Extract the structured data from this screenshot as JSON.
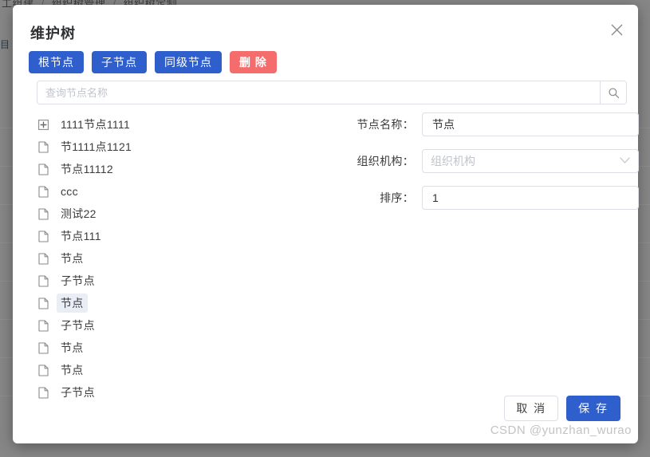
{
  "background": {
    "breadcrumb": [
      "工组建",
      "组织树管理",
      "组织树定制"
    ],
    "separator": "/",
    "sidebar_fragment": "目"
  },
  "dialog": {
    "title": "维护树",
    "close_icon": "close-icon",
    "actions": [
      {
        "label": "根节点",
        "style": "blue"
      },
      {
        "label": "子节点",
        "style": "blue"
      },
      {
        "label": "同级节点",
        "style": "blue"
      },
      {
        "label": "删 除",
        "style": "red"
      }
    ],
    "search": {
      "placeholder": "查询节点名称",
      "value": "",
      "button_icon": "search-icon"
    },
    "tree": [
      {
        "label": "1111节点1111",
        "icon": "expand-plus-icon",
        "selected": false
      },
      {
        "label": "节1111点1121",
        "icon": "file-icon",
        "selected": false
      },
      {
        "label": "节点11112",
        "icon": "file-icon",
        "selected": false
      },
      {
        "label": "ccc",
        "icon": "file-icon",
        "selected": false
      },
      {
        "label": "测试22",
        "icon": "file-icon",
        "selected": false
      },
      {
        "label": "节点111",
        "icon": "file-icon",
        "selected": false
      },
      {
        "label": "节点",
        "icon": "file-icon",
        "selected": false
      },
      {
        "label": "子节点",
        "icon": "file-icon",
        "selected": false
      },
      {
        "label": "节点",
        "icon": "file-icon",
        "selected": true
      },
      {
        "label": "子节点",
        "icon": "file-icon",
        "selected": false
      },
      {
        "label": "节点",
        "icon": "file-icon",
        "selected": false
      },
      {
        "label": "节点",
        "icon": "file-icon",
        "selected": false
      },
      {
        "label": "子节点",
        "icon": "file-icon",
        "selected": false
      }
    ],
    "form": [
      {
        "label": "节点名称：",
        "type": "input",
        "value": "节点",
        "placeholder": ""
      },
      {
        "label": "组织机构：",
        "type": "select",
        "value": "",
        "placeholder": "组织机构"
      },
      {
        "label": "排序：",
        "type": "input",
        "value": "1",
        "placeholder": ""
      }
    ],
    "footer": {
      "cancel_label": "取 消",
      "save_label": "保 存"
    }
  },
  "watermark": "CSDN @yunzhan_wurao",
  "colors": {
    "primary_blue": "#2f5fcd",
    "danger_red": "#f56c6c",
    "selected_node_bg": "#e9eef6",
    "backdrop": "#878787",
    "border": "#dcdfe6"
  }
}
